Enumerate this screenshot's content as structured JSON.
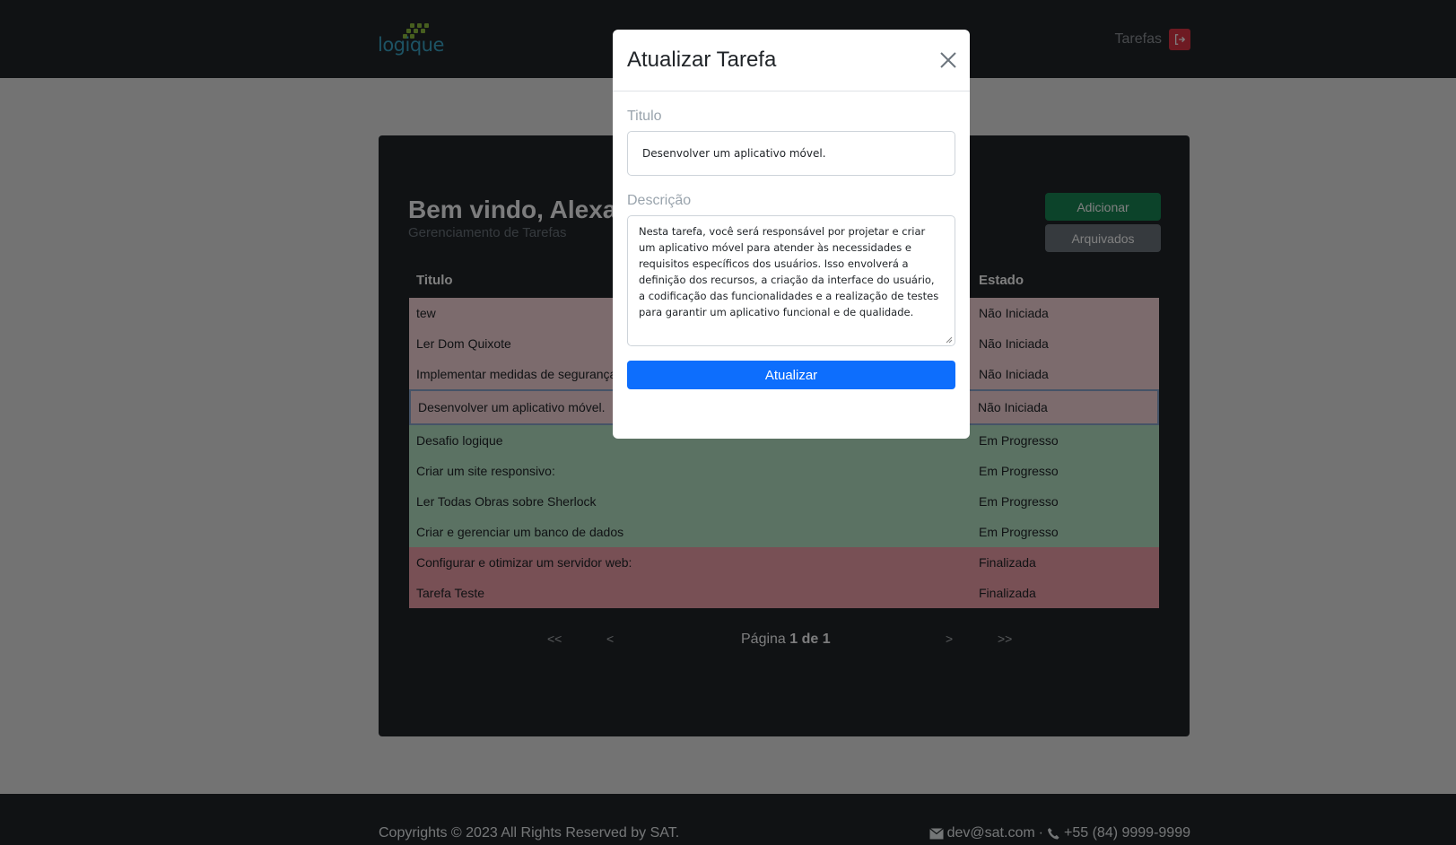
{
  "header": {
    "logo_text": "logique",
    "nav_link": "Tarefas"
  },
  "dashboard": {
    "welcome": "Bem vindo, Alexa",
    "subtitle": "Gerenciamento de Tarefas",
    "add_button": "Adicionar",
    "archived_button": "Arquivados",
    "columns": {
      "title": "Titulo",
      "state": "Estado"
    },
    "rows": [
      {
        "title": "tew",
        "state": "Não Iniciada"
      },
      {
        "title": "Ler Dom Quixote",
        "state": "Não Iniciada"
      },
      {
        "title": "Implementar medidas de segurança",
        "state": "Não Iniciada"
      },
      {
        "title": "Desenvolver um aplicativo móvel.",
        "state": "Não Iniciada"
      },
      {
        "title": "Desafio logique",
        "state": "Em Progresso"
      },
      {
        "title": "Criar um site responsivo:",
        "state": "Em Progresso"
      },
      {
        "title": "Ler Todas Obras sobre Sherlock",
        "state": "Em Progresso"
      },
      {
        "title": "Criar e gerenciar um banco de dados",
        "state": "Em Progresso"
      },
      {
        "title": "Configurar e otimizar um servidor web:",
        "state": "Finalizada"
      },
      {
        "title": "Tarefa Teste",
        "state": "Finalizada"
      }
    ],
    "pagination": {
      "first": "<<",
      "prev": "<",
      "label": "Página",
      "current": "1 de 1",
      "next": ">",
      "last": ">>"
    }
  },
  "footer": {
    "copyright": "Copyrights © 2023 All Rights Reserved by SAT.",
    "email": "dev@sat.com",
    "separator": "·",
    "phone": "+55 (84) 9999-9999"
  },
  "modal": {
    "title": "Atualizar Tarefa",
    "title_label": "Titulo",
    "title_value": "Desenvolver um aplicativo móvel.",
    "description_label": "Descrição",
    "description_value": "Nesta tarefa, você será responsável por projetar e criar um aplicativo móvel para atender às necessidades e requisitos específicos dos usuários. Isso envolverá a definição dos recursos, a criação da interface do usuário, a codificação das funcionalidades e a realização de testes para garantir um aplicativo funcional e de qualidade.",
    "submit_button": "Atualizar"
  },
  "colors": {
    "brand_green": "#8fbf3f",
    "brand_blue": "#3aa6c9",
    "primary": "#0d6efd",
    "success": "#198754",
    "danger": "#dc3545"
  }
}
